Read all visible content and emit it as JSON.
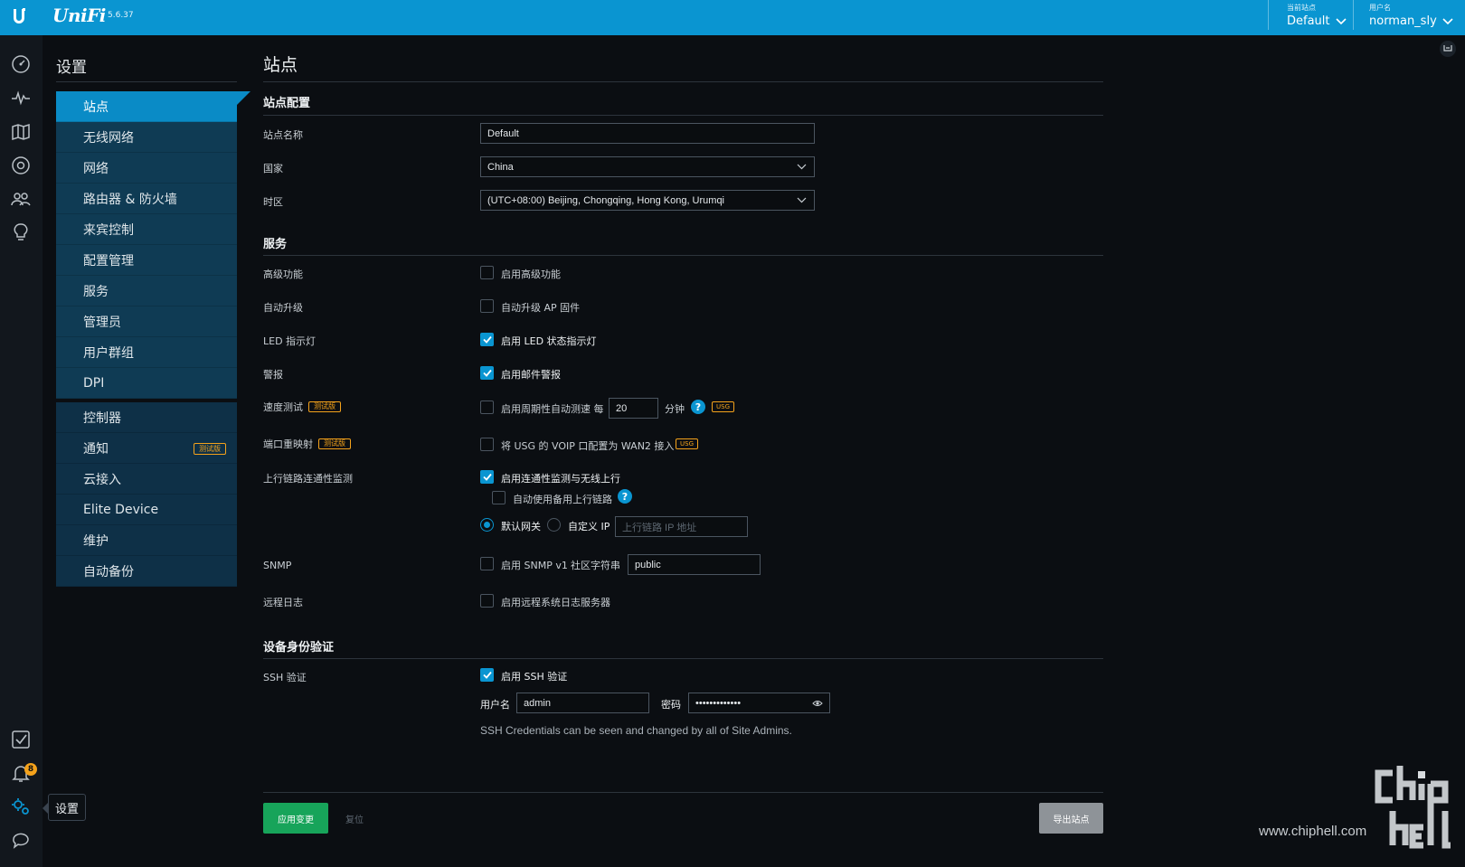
{
  "app": {
    "brand": "UniFi",
    "version": "5.6.37"
  },
  "topbar": {
    "site_caption": "当前站点",
    "site_value": "Default",
    "user_caption": "用户名",
    "user_value": "norman_sly"
  },
  "rail": {
    "icons": [
      "dashboard-icon",
      "statistics-icon",
      "map-icon",
      "devices-icon",
      "clients-icon",
      "insights-icon",
      "tasks-icon",
      "alerts-icon",
      "settings-icon",
      "chat-icon"
    ],
    "alerts_count": "8",
    "tooltip": "设置"
  },
  "settings_nav": {
    "title": "设置",
    "group1": [
      "站点",
      "无线网络",
      "网络",
      "路由器 & 防火墙",
      "来宾控制",
      "配置管理",
      "服务",
      "管理员",
      "用户群组",
      "DPI"
    ],
    "group2": [
      "控制器",
      "通知",
      "云接入",
      "Elite Device",
      "维护",
      "自动备份"
    ],
    "beta_label": "测试版"
  },
  "page": {
    "title": "站点",
    "site_config": {
      "heading": "站点配置",
      "site_name_label": "站点名称",
      "site_name_value": "Default",
      "country_label": "国家",
      "country_value": "China",
      "timezone_label": "时区",
      "timezone_value": "(UTC+08:00) Beijing, Chongqing, Hong Kong, Urumqi"
    },
    "services": {
      "heading": "服务",
      "advanced_label": "高级功能",
      "advanced_check": "启用高级功能",
      "advanced_checked": false,
      "autoupgrade_label": "自动升级",
      "autoupgrade_check": "自动升级 AP 固件",
      "autoupgrade_checked": false,
      "led_label": "LED 指示灯",
      "led_check": "启用 LED 状态指示灯",
      "led_checked": true,
      "alert_label": "警报",
      "alert_check": "启用邮件警报",
      "alert_checked": true,
      "speedtest_label": "速度测试",
      "speedtest_beta": "测试版",
      "speedtest_check": "启用周期性自动测速 每",
      "speedtest_interval": "20",
      "speedtest_unit": "分钟",
      "speedtest_help": "?",
      "usg_tag": "USG",
      "portremap_label": "端口重映射",
      "portremap_beta": "测试版",
      "portremap_check": "将 USG 的 VOIP 口配置为 WAN2 接入",
      "uplink_label": "上行链路连通性监测",
      "uplink_check": "启用连通性监测与无线上行",
      "uplink_checked": true,
      "uplink_auto_check": "自动使用备用上行链路",
      "uplink_help": "?",
      "gateway_default": "默认网关",
      "gateway_custom": "自定义 IP",
      "gateway_ip_placeholder": "上行链路 IP 地址",
      "snmp_label": "SNMP",
      "snmp_check": "启用 SNMP v1",
      "snmp_community_label": "社区字符串",
      "snmp_community_value": "public",
      "syslog_label": "远程日志",
      "syslog_check": "启用远程系统日志服务器"
    },
    "device_auth": {
      "heading": "设备身份验证",
      "ssh_label": "SSH 验证",
      "ssh_check": "启用 SSH 验证",
      "ssh_checked": true,
      "username_label": "用户名",
      "username_value": "admin",
      "password_label": "密码",
      "password_value": "•••••••••••••",
      "note": "SSH Credentials can be seen and changed by all of Site Admins."
    },
    "actions": {
      "apply": "应用变更",
      "reset": "复位",
      "export": "导出站点"
    }
  },
  "watermark": {
    "text": "www.chiphell.com"
  },
  "colors": {
    "accent": "#0a95d1",
    "apply": "#17a45a",
    "beta": "#f4a21b"
  }
}
